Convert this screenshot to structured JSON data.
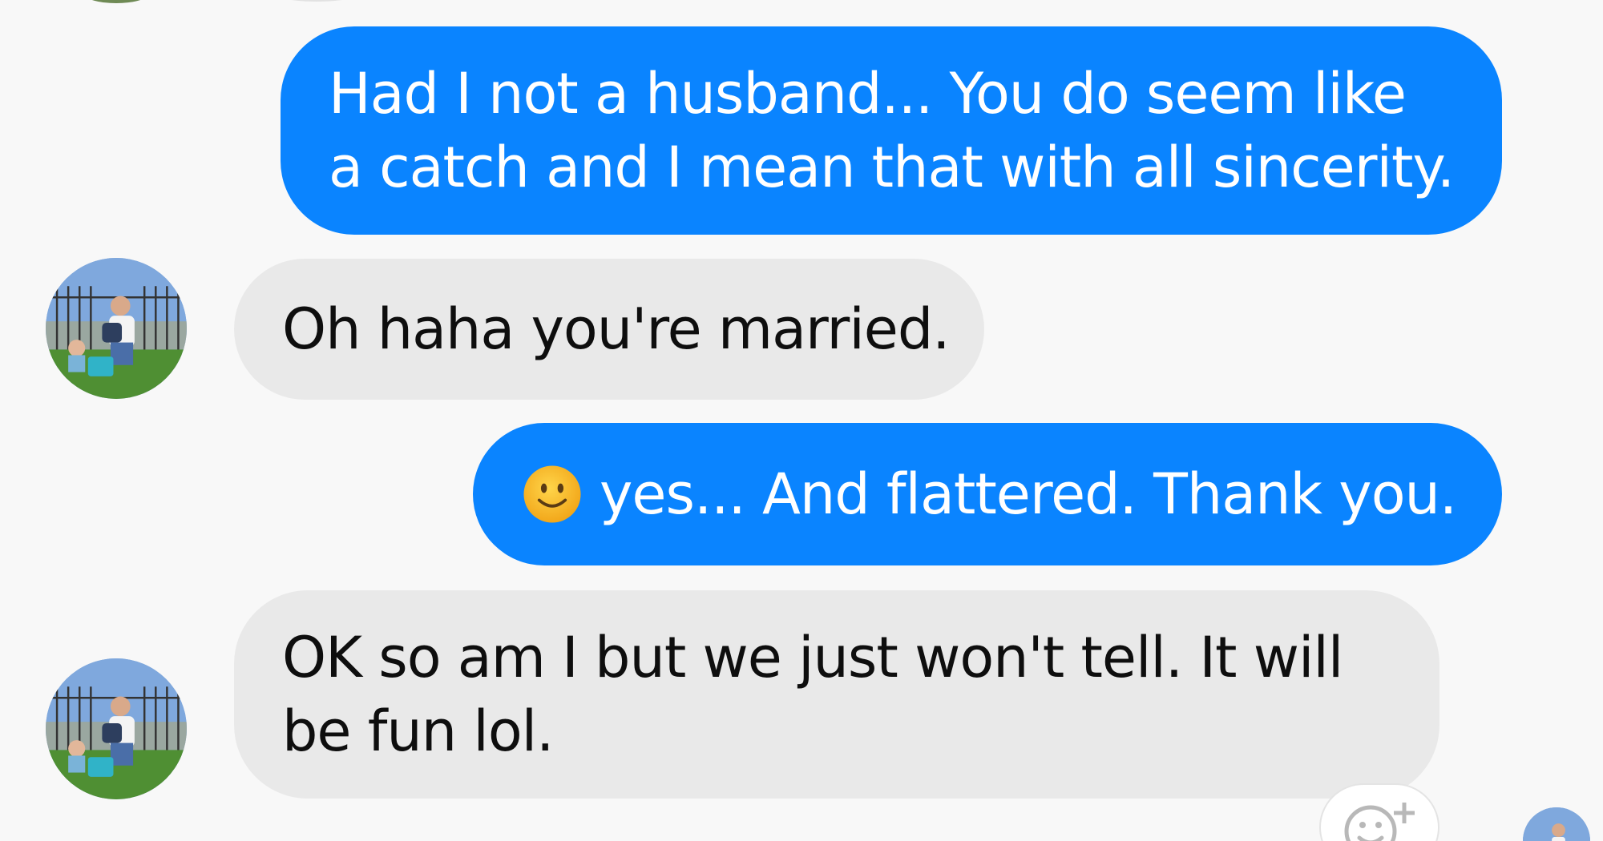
{
  "messages": [
    {
      "direction": "outgoing",
      "lines": [
        "Had I not a husband... You do seem like",
        "a catch and I mean that with all sincerity."
      ]
    },
    {
      "direction": "incoming",
      "lines": [
        "Oh haha you're married."
      ],
      "avatar": "contact-avatar"
    },
    {
      "direction": "outgoing",
      "emoji": "slightly-smiling-face-icon",
      "lines": [
        "yes... And flattered. Thank you."
      ]
    },
    {
      "direction": "incoming",
      "lines": [
        "OK so am I but we just won't tell. It will",
        "be fun lol."
      ],
      "avatar": "contact-avatar"
    }
  ],
  "colors": {
    "background": "#f8f8f8",
    "outgoing_bubble": "#0a84ff",
    "outgoing_text": "#ffffff",
    "incoming_bubble": "#e9e9e9",
    "incoming_text": "#0e0e0e"
  },
  "icons": {
    "reaction_button": "add-reaction-icon",
    "emoji": "slightly-smiling-face-icon"
  }
}
